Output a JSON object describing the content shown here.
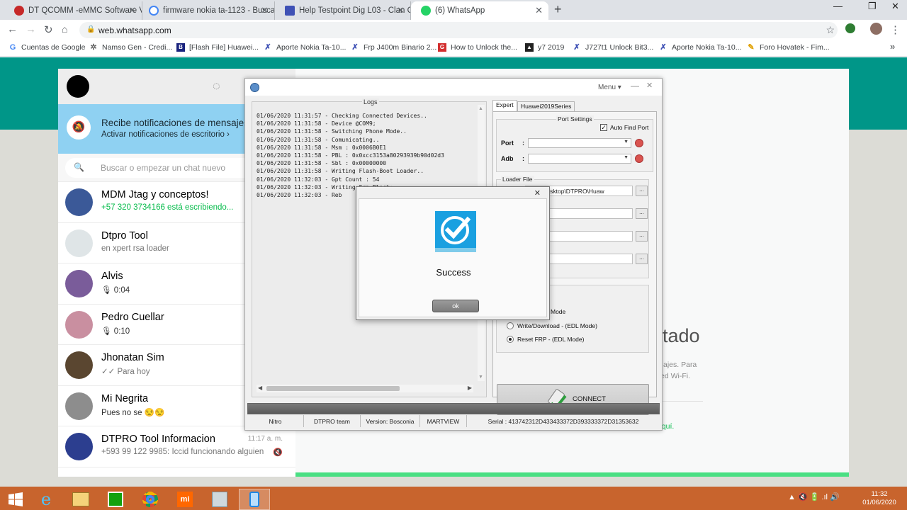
{
  "browser": {
    "tabs": [
      {
        "label": "DT QCOMM -eMMC Software V2",
        "color": "#c62828"
      },
      {
        "label": "firmware nokia ta-1123 - Buscar",
        "color": "#4285f4"
      },
      {
        "label": "Help Testpoint Dig L03 - Clan GS",
        "color": "#3f51b5"
      },
      {
        "label": "(6) WhatsApp",
        "color": "#25d366"
      }
    ],
    "url": "web.whatsapp.com",
    "bookmarks": [
      "Cuentas de Google",
      "Namso Gen - Credi...",
      "[Flash File] Huawei...",
      "Aporte Nokia Ta-10...",
      "Frp J400m Binario 2...",
      "How to Unlock the...",
      "y7 2019",
      "J727t1 Unlock Bit3...",
      "Aporte Nokia Ta-10...",
      "Foro Hovatek - Fim..."
    ],
    "overflow": "»"
  },
  "whatsapp": {
    "notification": {
      "title": "Recibe notificaciones de mensajes n",
      "subtitle": "Activar notificaciones de escritorio ›"
    },
    "search_placeholder": "Buscar o empezar un chat nuevo",
    "chats": [
      {
        "name": "MDM Jtag y conceptos!",
        "sub": "+57 320 3734166 está escribiendo...",
        "sub_color": "#07bc4c",
        "avatar": "#3b5998"
      },
      {
        "name": "Dtpro Tool",
        "sub": "en xpert rsa loader",
        "sub_color": "#777",
        "avatar": "#dfe5e7"
      },
      {
        "name": "Alvis",
        "sub": "🎙 0:04",
        "sub_color": "#333",
        "avatar": "#7a5c9a"
      },
      {
        "name": "Pedro Cuellar",
        "sub": "🎙 0:10",
        "sub_color": "#333",
        "avatar": "#c98fa0"
      },
      {
        "name": "Jhonatan Sim",
        "sub": "✓✓ Para hoy",
        "sub_color": "#777",
        "avatar": "#5a4630"
      },
      {
        "name": "Mi Negrita",
        "sub": "Pues no se 😒😒",
        "sub_color": "#333",
        "avatar": "#8d8d8d"
      },
      {
        "name": "DTPRO Tool Informacion",
        "sub": "+593 99 122 9985: Iccid funcionando alguien",
        "sub_color": "#777",
        "avatar": "#2c3e8f",
        "time": "11:17 a. m."
      }
    ],
    "right": {
      "title": "tado",
      "p1": "ajes. Para",
      "p2": "ed Wi-Fi.",
      "link": "aquí."
    }
  },
  "dtpro": {
    "menu": "Menu ▾",
    "logs_label": "Logs",
    "logs": [
      "01/06/2020 11:31:57 - Checking Connected Devices..",
      "01/06/2020 11:31:58 - Device @COM9;",
      "01/06/2020 11:31:58 - Switching Phone Mode..",
      "01/06/2020 11:31:58 - Comunicating..",
      "01/06/2020 11:31:58 - Msm : 0x0006B0E1",
      "01/06/2020 11:31:58 - PBL : 0x0xcc3153a80293939b90d02d3",
      "01/06/2020 11:31:58 - Sbl : 0x00000000",
      "01/06/2020 11:31:58 - Writing Flash-Boot Loader..",
      "01/06/2020 11:32:03 - Gpt Count : 54",
      "01/06/2020 11:32:03 - Writing Frp Block;",
      "01/06/2020 11:32:03 - Reb"
    ],
    "tabs": [
      "Expert",
      "Huawei2019Series"
    ],
    "port_settings": "Port Settings",
    "auto_find_port": "Auto Find Port",
    "port_label": "Port",
    "adb_label": "Adb",
    "loader_path": "arejo\\Desktop\\DTPRO\\Huaw",
    "file_label": "e :",
    "loader_caption": "Loader File",
    "dots": "...",
    "modes": [
      {
        "label": "Mode",
        "selected": false
      },
      {
        "label": "Write/Download - (EDL Mode)",
        "selected": false
      },
      {
        "label": "Reset FRP - (EDL Mode)",
        "selected": true
      }
    ],
    "connect": "CONNECT",
    "status": [
      "Nitro",
      "DTPRO team",
      "Version: Bosconia",
      "MARTVIEW",
      "Serial : 413742312D433433372D393333372D31353632"
    ]
  },
  "dialog": {
    "message": "Success",
    "ok": "ok",
    "close": "✕"
  },
  "taskbar": {
    "tray": "▲  🔇 🔋 .ıl 🔊",
    "time": "11:32",
    "date": "01/06/2020"
  }
}
